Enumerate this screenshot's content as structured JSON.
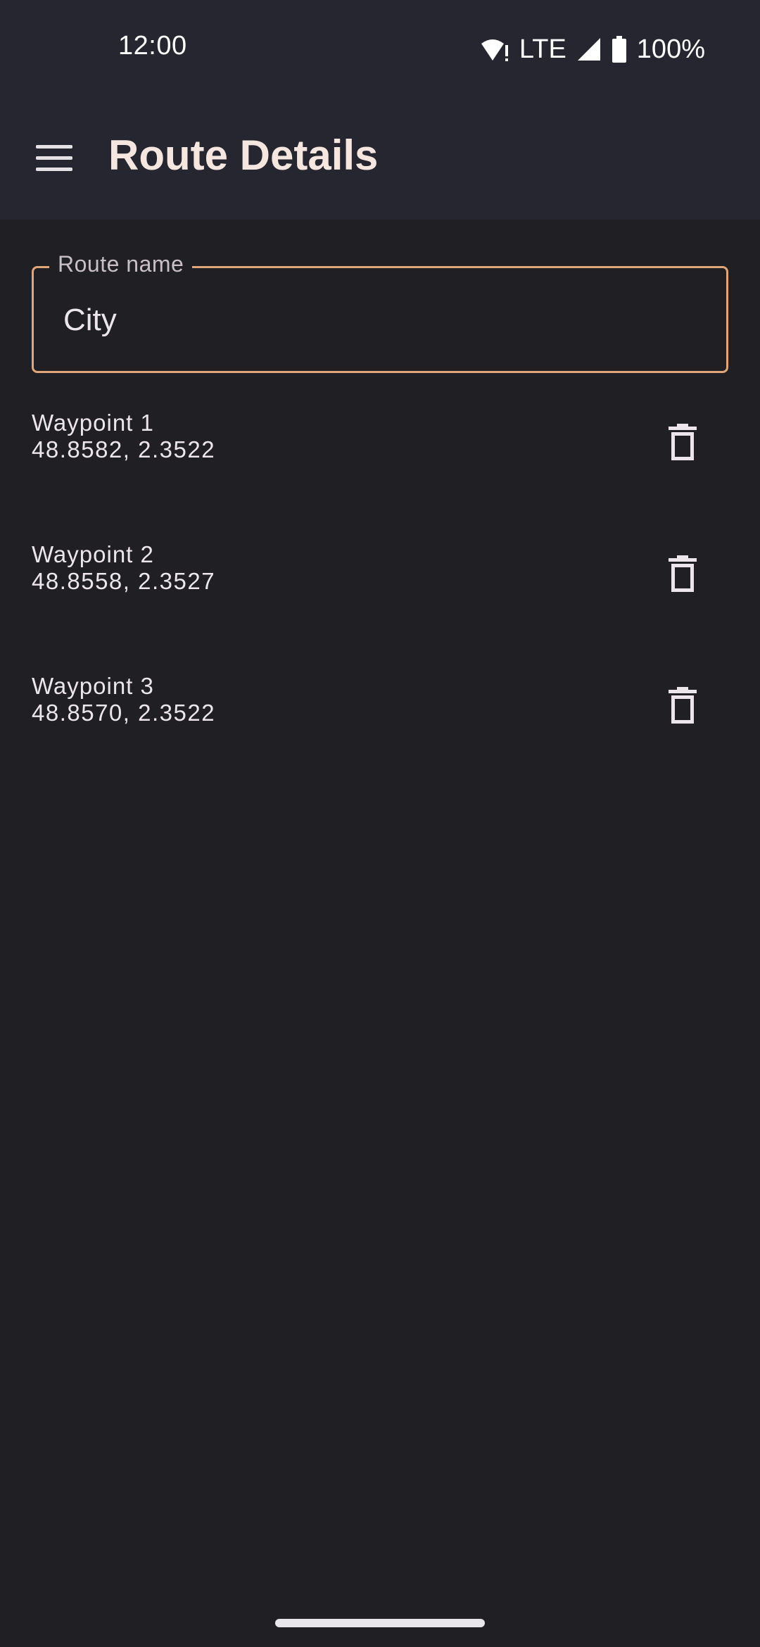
{
  "status_bar": {
    "time": "12:00",
    "network": "LTE",
    "battery": "100%",
    "icons": [
      "wifi-alert-icon",
      "signal-icon",
      "battery-icon"
    ]
  },
  "app_bar": {
    "title": "Route Details",
    "menu_icon": "menu-icon"
  },
  "route_field": {
    "label": "Route name",
    "value": "City"
  },
  "waypoints": [
    {
      "name": "Waypoint 1",
      "coords": "48.8582, 2.3522"
    },
    {
      "name": "Waypoint 2",
      "coords": "48.8558, 2.3527"
    },
    {
      "name": "Waypoint 3",
      "coords": "48.8570, 2.3522"
    }
  ],
  "colors": {
    "background": "#1f1f24",
    "app_bar": "#25262f",
    "field_border": "#e0a578",
    "title_text": "#f5e6e0"
  }
}
